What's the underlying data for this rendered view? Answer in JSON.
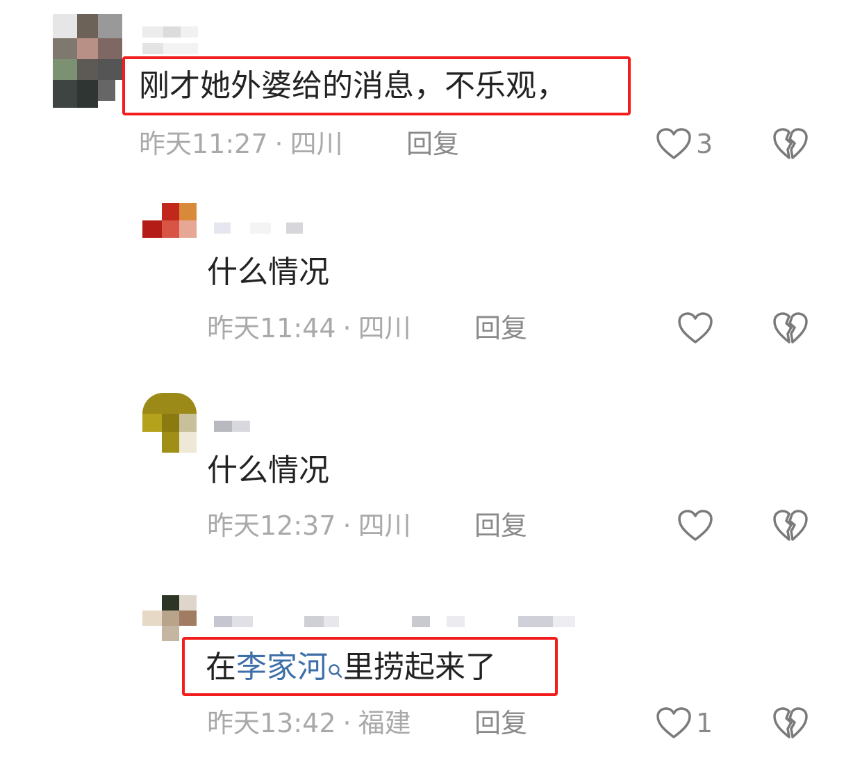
{
  "comments": [
    {
      "text": "刚才她外婆给的消息，不乐观，",
      "time": "昨天11:27",
      "location": "四川",
      "reply_label": "回复",
      "likes": "3"
    },
    {
      "text": "什么情况",
      "time": "昨天11:44",
      "location": "四川",
      "reply_label": "回复",
      "likes": ""
    },
    {
      "text": "什么情况",
      "time": "昨天12:37",
      "location": "四川",
      "reply_label": "回复",
      "likes": ""
    },
    {
      "text_before": "在",
      "text_link": "李家河",
      "text_after": "里捞起来了",
      "time": "昨天13:42",
      "location": "福建",
      "reply_label": "回复",
      "likes": "1"
    }
  ],
  "separator": "·",
  "colors": {
    "highlight": "#f21d1d",
    "link": "#3e6fa8",
    "meta": "#a9a9a9"
  }
}
